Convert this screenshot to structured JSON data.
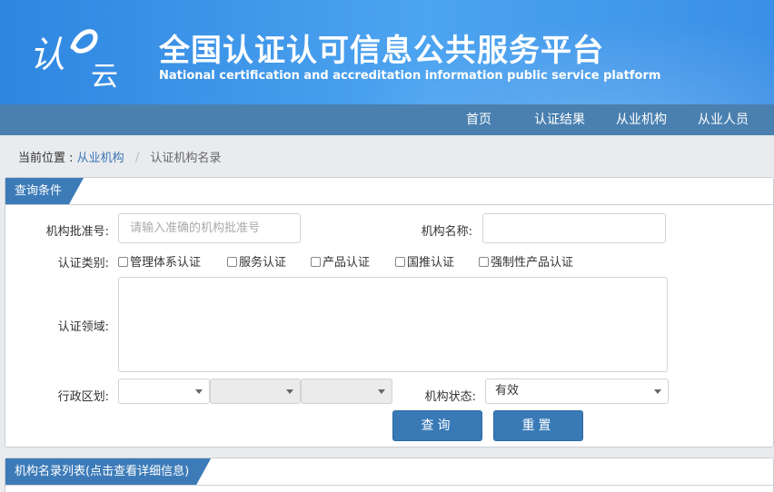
{
  "header": {
    "title": "全国认证认可信息公共服务平台",
    "subtitle": "National certification and accreditation information public service platform",
    "logo_text": "认云"
  },
  "nav": {
    "items": [
      {
        "label": "首页"
      },
      {
        "label": "认证结果"
      },
      {
        "label": "从业机构"
      },
      {
        "label": "从业人员"
      }
    ]
  },
  "breadcrumb": {
    "prefix": "当前位置 :",
    "link": "从业机构",
    "separator": "/",
    "current": "认证机构名录"
  },
  "query_panel": {
    "tab_label": "查询条件",
    "approval_no": {
      "label": "机构批准号:",
      "placeholder": "请输入准确的机构批准号",
      "value": ""
    },
    "org_name": {
      "label": "机构名称:",
      "value": ""
    },
    "cert_type": {
      "label": "认证类别:",
      "options": [
        {
          "label": "管理体系认证",
          "checked": false
        },
        {
          "label": "服务认证",
          "checked": false
        },
        {
          "label": "产品认证",
          "checked": false
        },
        {
          "label": "国推认证",
          "checked": false
        },
        {
          "label": "强制性产品认证",
          "checked": false
        }
      ]
    },
    "cert_field": {
      "label": "认证领域:"
    },
    "region": {
      "label": "行政区划:",
      "province": "",
      "city": "",
      "district": ""
    },
    "status": {
      "label": "机构状态:",
      "selected": "有效"
    },
    "search_button": "查询",
    "reset_button": "重置"
  },
  "list_panel": {
    "tab_label": "机构名录列表(点击查看详细信息)"
  },
  "colors": {
    "header_blue": "#3a8fe6",
    "nav_blue": "#4a80b0",
    "accent": "#3d7bb8",
    "link": "#3b76b6"
  }
}
